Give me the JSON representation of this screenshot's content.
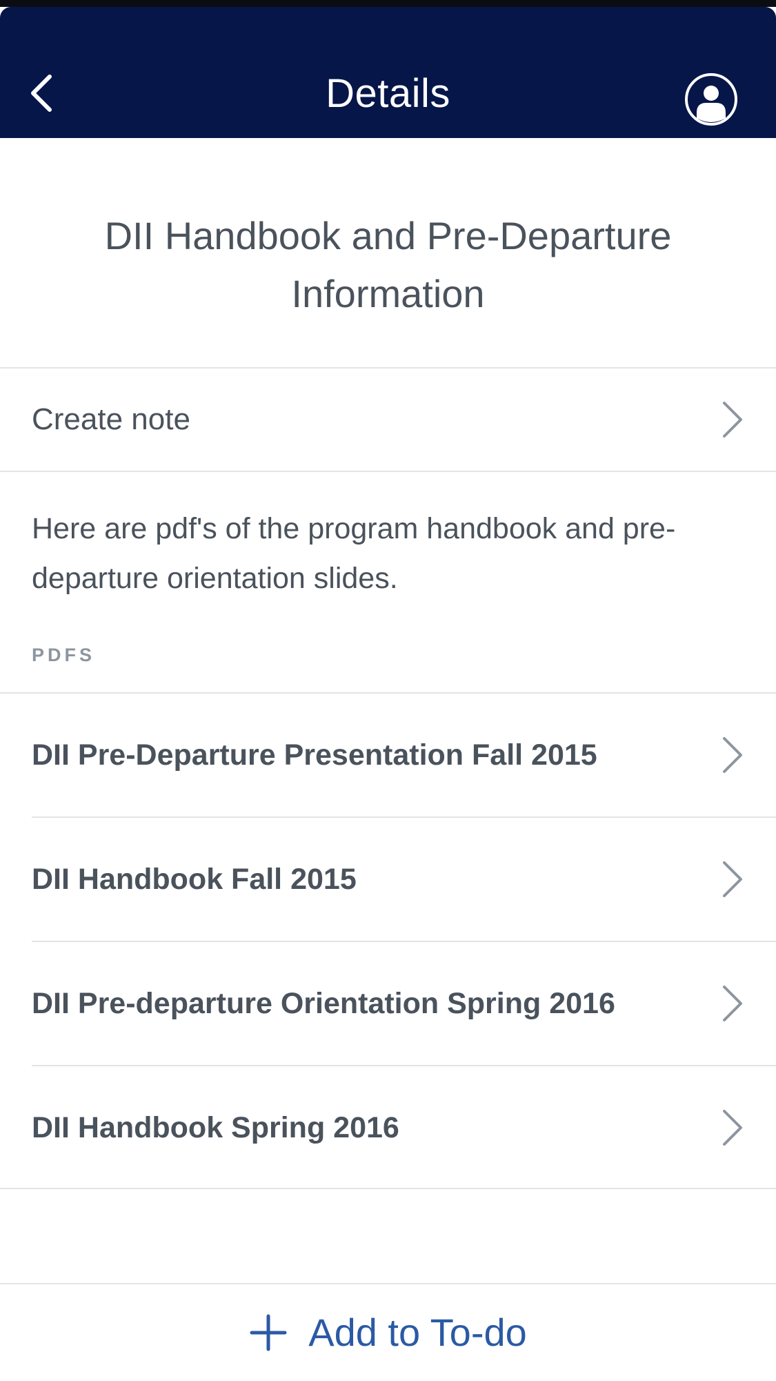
{
  "header": {
    "title": "Details"
  },
  "item": {
    "title": "DII Handbook and Pre-Departure Information",
    "create_note_label": "Create note",
    "description": "Here are pdf's of the program handbook and pre-departure orientation slides."
  },
  "pdfs": {
    "section_label": "PDFS",
    "items": [
      {
        "label": "DII Pre-Departure Presentation Fall 2015"
      },
      {
        "label": "DII Handbook Fall 2015"
      },
      {
        "label": "DII Pre-departure Orientation Spring 2016"
      },
      {
        "label": "DII Handbook Spring 2016"
      }
    ]
  },
  "footer": {
    "add_label": "Add to To-do"
  },
  "colors": {
    "navbar": "#061649",
    "accent": "#2b5aa4",
    "text": "#4a525c"
  }
}
